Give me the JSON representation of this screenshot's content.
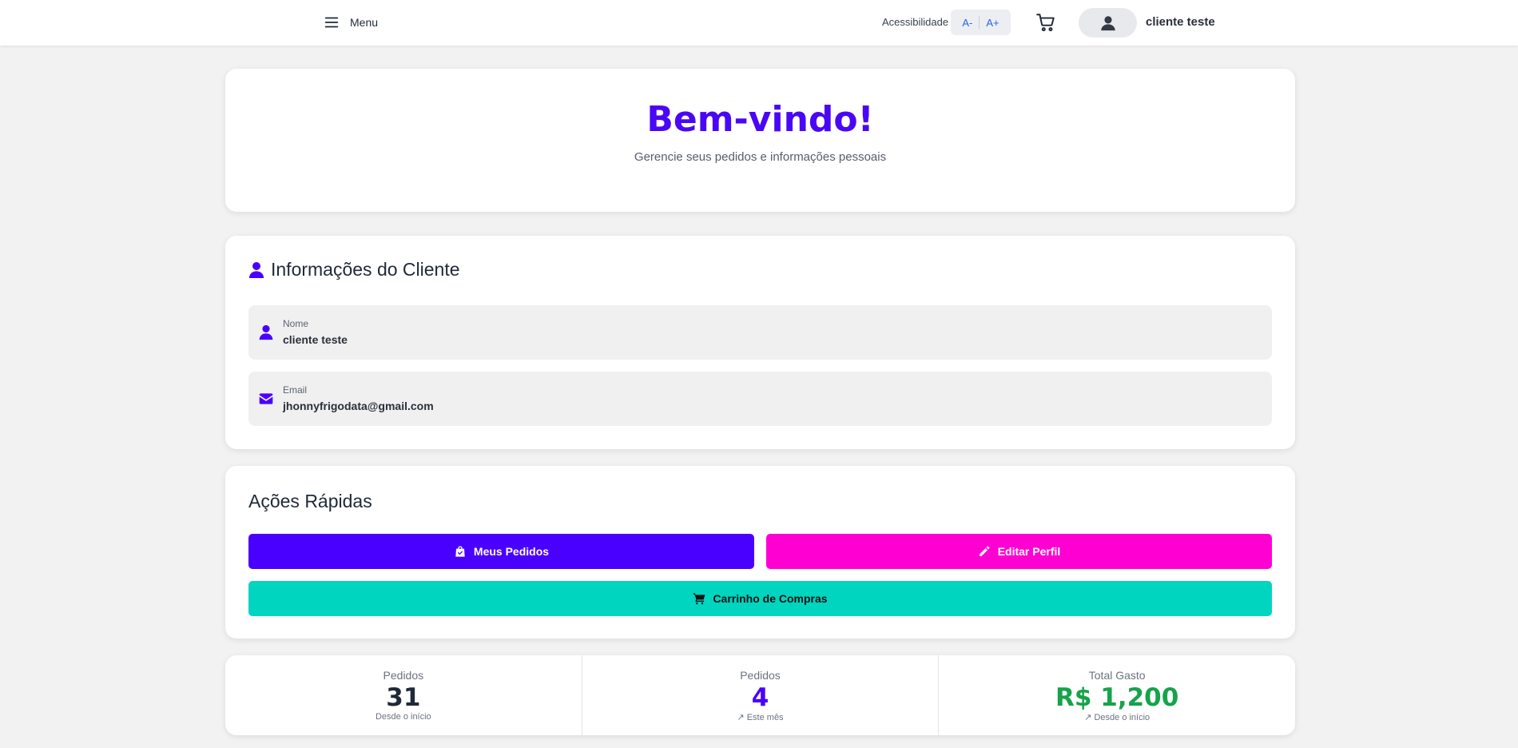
{
  "header": {
    "menu_label": "Menu",
    "accessibility_label": "Acessibilidade",
    "font_decrease": "A-",
    "font_increase": "A+",
    "user_name": "cliente teste"
  },
  "welcome": {
    "title": "Bem-vindo!",
    "subtitle": "Gerencie seus pedidos e informações pessoais"
  },
  "client_info": {
    "title": "Informações do Cliente",
    "fields": [
      {
        "label": "Nome",
        "value": "cliente teste",
        "icon": "user-icon"
      },
      {
        "label": "Email",
        "value": "jhonnyfrigodata@gmail.com",
        "icon": "envelope-icon"
      }
    ]
  },
  "quick_actions": {
    "title": "Ações Rápidas",
    "buttons": [
      {
        "label": "Meus Pedidos",
        "icon": "shopping-bag-icon",
        "color": "#4a00ff",
        "text_color": "#ffffff"
      },
      {
        "label": "Editar Perfil",
        "icon": "pencil-icon",
        "color": "#ff00d3",
        "text_color": "#ffffff"
      },
      {
        "label": "Carrinho de Compras",
        "icon": "cart-icon",
        "color": "#00d5c0",
        "text_color": "#111111"
      }
    ]
  },
  "stats": [
    {
      "label": "Pedidos",
      "value": "31",
      "sub": "Desde o início",
      "color": "#1f2937"
    },
    {
      "label": "Pedidos",
      "value": "4",
      "sub": "↗ Este mês",
      "color": "#4a00ff"
    },
    {
      "label": "Total Gasto",
      "value": "R$ 1,200",
      "sub": "↗ Desde o início",
      "color": "#16a34a"
    }
  ],
  "colors": {
    "primary": "#4a00ff",
    "secondary": "#ff00d3",
    "accent": "#00d5c0",
    "success": "#16a34a",
    "background": "#f2f2f2"
  }
}
